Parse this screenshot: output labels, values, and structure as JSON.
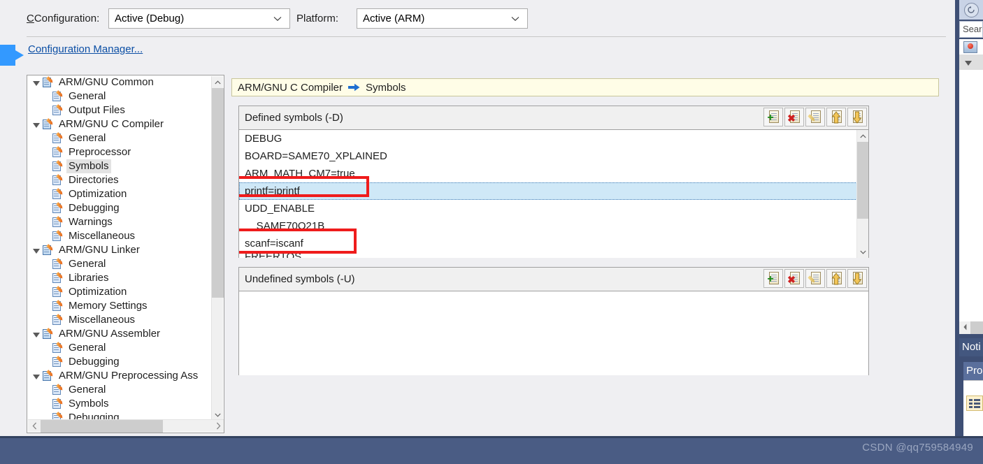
{
  "toolbar": {
    "configuration_label": "Configuration:",
    "configuration_value": "Active (Debug)",
    "platform_label": "Platform:",
    "platform_value": "Active (ARM)",
    "configuration_manager_link": "Configuration Manager..."
  },
  "tree": {
    "items": [
      {
        "label": "ARM/GNU Common",
        "level": 0,
        "expanded": true,
        "selected": false
      },
      {
        "label": "General",
        "level": 1,
        "expanded": false,
        "selected": false
      },
      {
        "label": "Output Files",
        "level": 1,
        "expanded": false,
        "selected": false
      },
      {
        "label": "ARM/GNU C Compiler",
        "level": 0,
        "expanded": true,
        "selected": false
      },
      {
        "label": "General",
        "level": 1,
        "expanded": false,
        "selected": false
      },
      {
        "label": "Preprocessor",
        "level": 1,
        "expanded": false,
        "selected": false
      },
      {
        "label": "Symbols",
        "level": 1,
        "expanded": false,
        "selected": true
      },
      {
        "label": "Directories",
        "level": 1,
        "expanded": false,
        "selected": false
      },
      {
        "label": "Optimization",
        "level": 1,
        "expanded": false,
        "selected": false
      },
      {
        "label": "Debugging",
        "level": 1,
        "expanded": false,
        "selected": false
      },
      {
        "label": "Warnings",
        "level": 1,
        "expanded": false,
        "selected": false
      },
      {
        "label": "Miscellaneous",
        "level": 1,
        "expanded": false,
        "selected": false
      },
      {
        "label": "ARM/GNU Linker",
        "level": 0,
        "expanded": true,
        "selected": false
      },
      {
        "label": "General",
        "level": 1,
        "expanded": false,
        "selected": false
      },
      {
        "label": "Libraries",
        "level": 1,
        "expanded": false,
        "selected": false
      },
      {
        "label": "Optimization",
        "level": 1,
        "expanded": false,
        "selected": false
      },
      {
        "label": "Memory Settings",
        "level": 1,
        "expanded": false,
        "selected": false
      },
      {
        "label": "Miscellaneous",
        "level": 1,
        "expanded": false,
        "selected": false
      },
      {
        "label": "ARM/GNU Assembler",
        "level": 0,
        "expanded": true,
        "selected": false
      },
      {
        "label": "General",
        "level": 1,
        "expanded": false,
        "selected": false
      },
      {
        "label": "Debugging",
        "level": 1,
        "expanded": false,
        "selected": false
      },
      {
        "label": "ARM/GNU Preprocessing Ass",
        "level": 0,
        "expanded": true,
        "selected": false
      },
      {
        "label": "General",
        "level": 1,
        "expanded": false,
        "selected": false
      },
      {
        "label": "Symbols",
        "level": 1,
        "expanded": false,
        "selected": false
      },
      {
        "label": "Debugging",
        "level": 1,
        "expanded": false,
        "selected": false
      }
    ]
  },
  "breadcrumb": {
    "category": "ARM/GNU C Compiler",
    "page": "Symbols"
  },
  "defined_symbols": {
    "title": "Defined symbols (-D)",
    "tools": [
      {
        "name": "add-symbol-button",
        "title": "Add"
      },
      {
        "name": "delete-symbol-button",
        "title": "Delete"
      },
      {
        "name": "edit-symbol-button",
        "title": "Edit"
      },
      {
        "name": "move-up-button",
        "title": "Move Up"
      },
      {
        "name": "move-down-button",
        "title": "Move Down"
      }
    ],
    "rows": [
      {
        "value": "DEBUG",
        "selected": false,
        "highlighted": false
      },
      {
        "value": "BOARD=SAME70_XPLAINED",
        "selected": false,
        "highlighted": false
      },
      {
        "value": "ARM_MATH_CM7=true",
        "selected": false,
        "highlighted": false
      },
      {
        "value": "printf=iprintf",
        "selected": true,
        "highlighted": true
      },
      {
        "value": "UDD_ENABLE",
        "selected": false,
        "highlighted": false
      },
      {
        "value": "__SAME70Q21B__",
        "selected": false,
        "highlighted": false
      },
      {
        "value": "scanf=iscanf",
        "selected": false,
        "highlighted": true
      },
      {
        "value": "FREERTOS",
        "selected": false,
        "highlighted": false
      }
    ]
  },
  "undefined_symbols": {
    "title": "Undefined symbols (-U)",
    "tools": [
      {
        "name": "add-symbol-button",
        "title": "Add"
      },
      {
        "name": "delete-symbol-button",
        "title": "Delete"
      },
      {
        "name": "edit-symbol-button",
        "title": "Edit"
      },
      {
        "name": "move-up-button",
        "title": "Move Up"
      },
      {
        "name": "move-down-button",
        "title": "Move Down"
      }
    ],
    "rows": []
  },
  "right_sidebar": {
    "back_icon": "back-arrow-icon",
    "search_placeholder": "Sear",
    "search_value": "Sear",
    "notifications_label": "Noti",
    "properties_label": "Prop"
  },
  "watermark": "CSDN @qq759584949",
  "colors": {
    "accent_blue": "#3399ff",
    "annotation_red": "#ef1c1c",
    "selection_blue": "#cfe8f7",
    "breadcrumb_yellow": "#fffde7",
    "chrome_blue": "#3e4f75"
  }
}
